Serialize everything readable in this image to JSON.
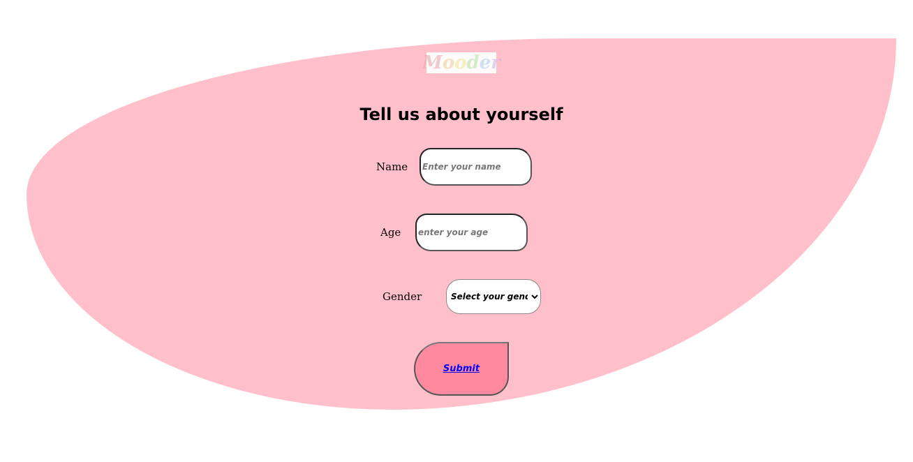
{
  "brand": {
    "logo_text": "Mooder",
    "logo_letter_colors": [
      "#e8a0a8",
      "#f0c890",
      "#f0e68c",
      "#b8e0a0",
      "#a8c8e8",
      "#c8b0e0"
    ]
  },
  "colors": {
    "background_blob": "#ffc0cb",
    "submit_fill": "#ff8aa0",
    "link": "#0000ee"
  },
  "form": {
    "title": "Tell us about yourself",
    "name": {
      "label": "Name",
      "placeholder": "Enter your name",
      "value": ""
    },
    "age": {
      "label": "Age",
      "placeholder": "enter your age",
      "value": ""
    },
    "gender": {
      "label": "Gender",
      "selected": "Select your gender"
    },
    "submit_label": "Submit"
  }
}
